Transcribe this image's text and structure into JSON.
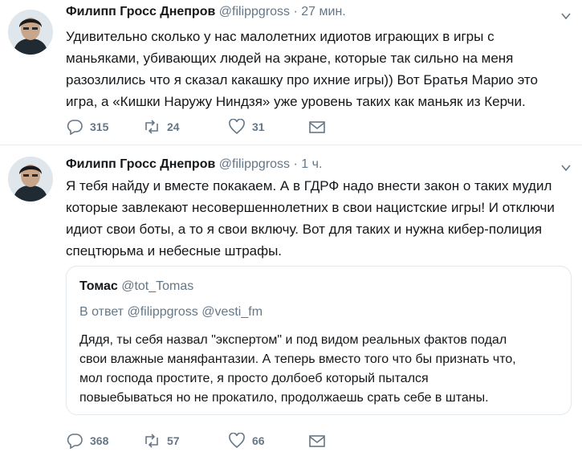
{
  "tweets": [
    {
      "author": "Филипп Гросс Днепров",
      "handle": "@filippgross",
      "separator": "·",
      "time": "27 мин.",
      "lines": [
        "Удивительно сколько у нас малолетних идиотов играющих в игры с",
        "маньяками, убивающих людей на экране, которые так сильно на меня",
        "разозлились что я сказал какашку про ихние игры)) Вот Братья Марио это",
        "игра, а «Кишки Наружу Ниндзя» уже уровень таких как маньяк из Керчи."
      ],
      "replies": "315",
      "retweets": "24",
      "likes": "31"
    },
    {
      "author": "Филипп Гросс Днепров",
      "handle": "@filippgross",
      "separator": "·",
      "time": "1 ч.",
      "lines": [
        "Я тебя найду и вместе покакаем. А в ГДРФ надо внести закон о таких мудил",
        "которые завлекают несовершеннолетних в свои нацистские игры! И отключи",
        "идиот свои боты, а то я свои включу. Вот для таких и нужна кибер-полиция",
        "спецтюрьма и небесные штрафы."
      ],
      "replies": "368",
      "retweets": "57",
      "likes": "66",
      "quote": {
        "author": "Томас",
        "handle": "@tot_Tomas",
        "reply_prefix": "В ответ",
        "reply_to_1": "@filippgross",
        "reply_to_2": "@vesti_fm",
        "lines": [
          "Дядя, ты себя назвал \"экспертом\" и под видом реальных фактов подал",
          "свои влажные маняфантазии. А теперь вместо того что бы признать что,",
          "мол господа простите, я просто долбоеб который пытался",
          "повыебываться но не прокатило, продолжаешь срать себе в штаны."
        ]
      }
    }
  ],
  "colors": {
    "text": "#14171a",
    "secondary": "#657786",
    "border": "#e6ecf0"
  },
  "icons": [
    "avatar",
    "chevron-down-icon",
    "reply-icon",
    "retweet-icon",
    "like-icon",
    "dm-icon"
  ]
}
